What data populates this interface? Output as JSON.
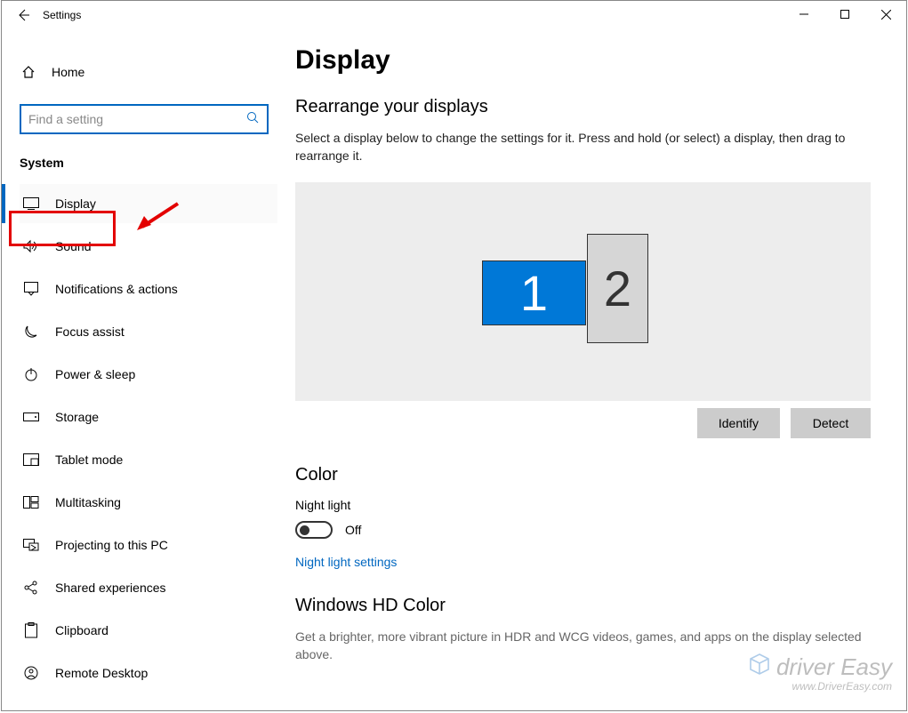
{
  "window": {
    "title": "Settings"
  },
  "sidebar": {
    "home_label": "Home",
    "search_placeholder": "Find a setting",
    "section_label": "System",
    "items": [
      {
        "label": "Display"
      },
      {
        "label": "Sound"
      },
      {
        "label": "Notifications & actions"
      },
      {
        "label": "Focus assist"
      },
      {
        "label": "Power & sleep"
      },
      {
        "label": "Storage"
      },
      {
        "label": "Tablet mode"
      },
      {
        "label": "Multitasking"
      },
      {
        "label": "Projecting to this PC"
      },
      {
        "label": "Shared experiences"
      },
      {
        "label": "Clipboard"
      },
      {
        "label": "Remote Desktop"
      }
    ]
  },
  "main": {
    "title": "Display",
    "rearrange_heading": "Rearrange your displays",
    "rearrange_desc": "Select a display below to change the settings for it. Press and hold (or select) a display, then drag to rearrange it.",
    "monitor1": "1",
    "monitor2": "2",
    "identify_label": "Identify",
    "detect_label": "Detect",
    "color_heading": "Color",
    "night_light_label": "Night light",
    "toggle_state": "Off",
    "night_light_link": "Night light settings",
    "hd_heading": "Windows HD Color",
    "hd_desc": "Get a brighter, more vibrant picture in HDR and WCG videos, games, and apps on the display selected above."
  },
  "watermark": {
    "brand": "driver Easy",
    "url": "www.DriverEasy.com"
  }
}
